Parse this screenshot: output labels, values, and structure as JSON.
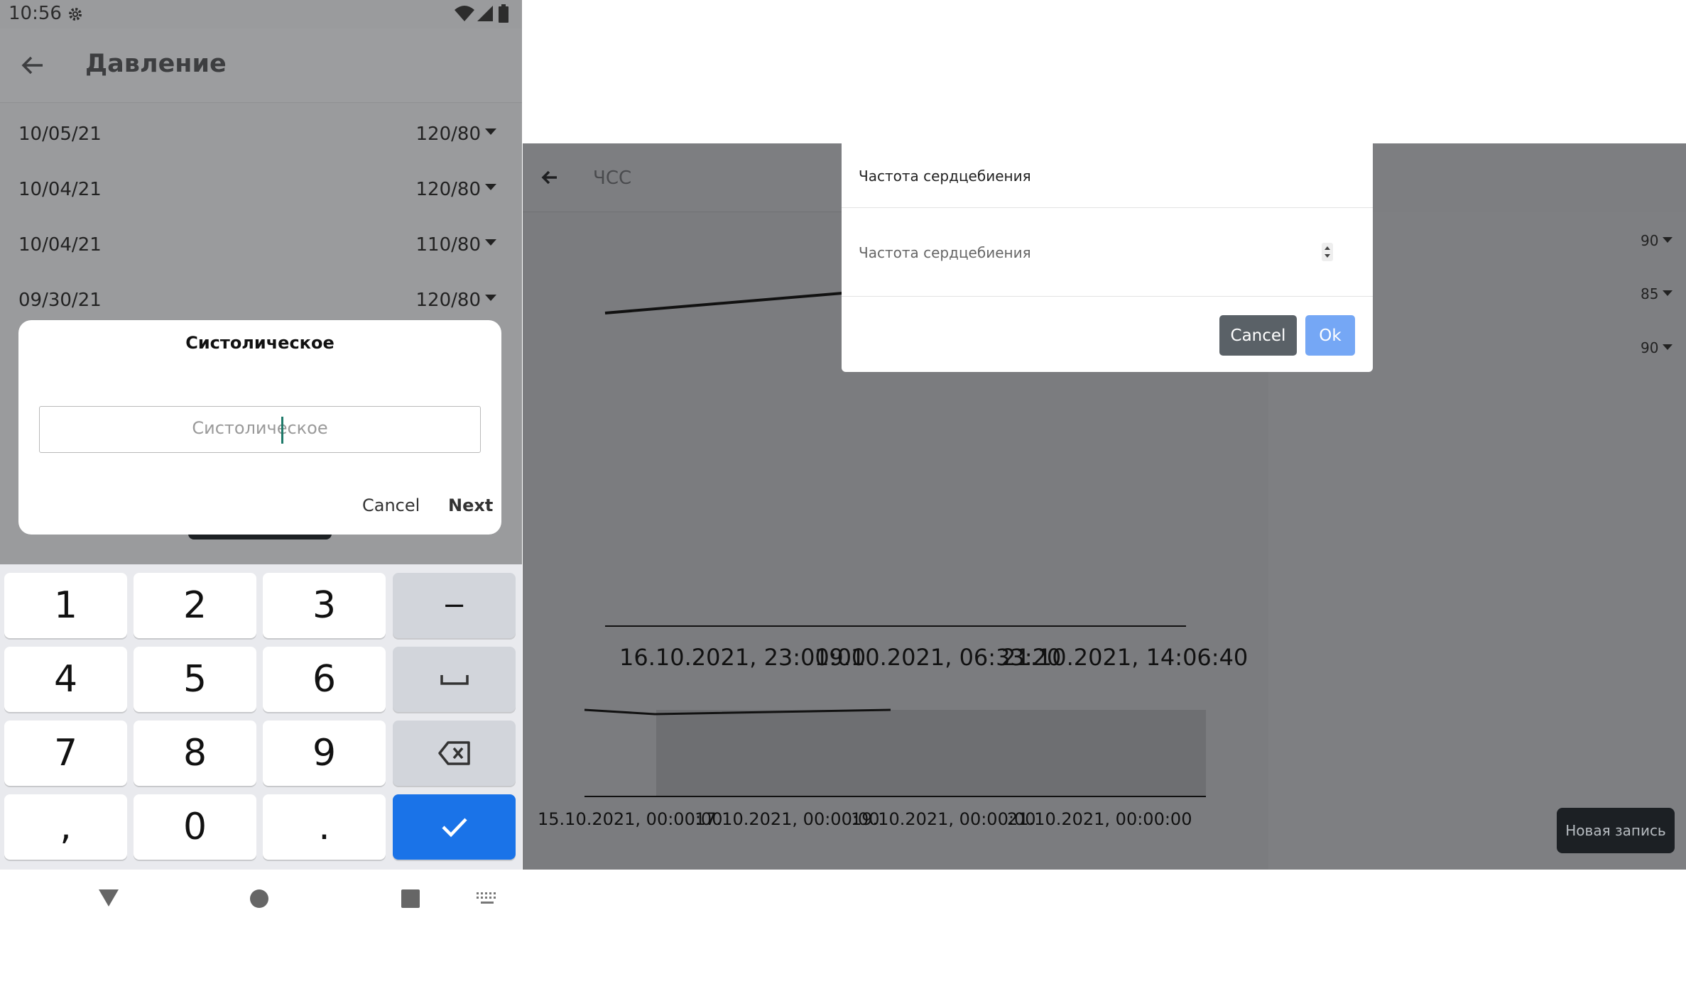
{
  "status_bar": {
    "time": "10:56"
  },
  "left_app": {
    "title": "Давление",
    "rows": [
      {
        "date": "10/05/21",
        "value": "120/80"
      },
      {
        "date": "10/04/21",
        "value": "120/80"
      },
      {
        "date": "10/04/21",
        "value": "110/80"
      },
      {
        "date": "09/30/21",
        "value": "120/80"
      }
    ],
    "dialog": {
      "title": "Систолическое",
      "placeholder": "Систолическое",
      "cancel": "Cancel",
      "next": "Next"
    },
    "keyboard": {
      "keys": [
        "1",
        "2",
        "3",
        "−",
        "4",
        "5",
        "6",
        "␣",
        "7",
        "8",
        "9",
        "⌫",
        ",",
        "0",
        ".",
        "✓"
      ]
    }
  },
  "right_app": {
    "title": "ЧСС",
    "list_values": [
      "90",
      "85",
      "90"
    ],
    "new_record_button": "Новая запись",
    "chart_main_x_labels": [
      "16.10.2021, 23:00:00",
      "19.10.2021, 06:33:20",
      "21.10.2021, 14:06:40"
    ],
    "chart_nav_x_labels": [
      "15.10.2021, 00:00:00",
      "17.10.2021, 00:00:00",
      "19.10.2021, 00:00:00",
      "21.10.2021, 00:00:00"
    ],
    "dialog": {
      "title": "Частота сердцебиения",
      "placeholder": "Частота сердцебиения",
      "cancel": "Cancel",
      "ok": "Ok"
    }
  }
}
